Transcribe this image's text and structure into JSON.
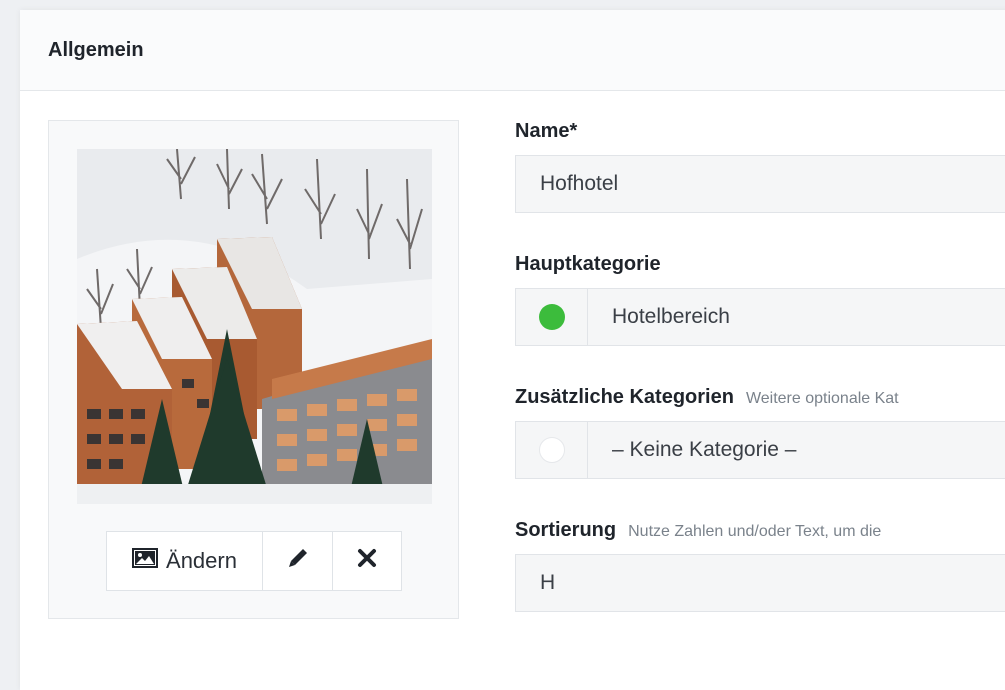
{
  "section": {
    "title": "Allgemein"
  },
  "image_actions": {
    "change_label": "Ändern"
  },
  "fields": {
    "name": {
      "label": "Name*",
      "value": "Hofhotel"
    },
    "main_category": {
      "label": "Hauptkategorie",
      "value": "Hotelbereich",
      "color": "#3cbc3c"
    },
    "additional_categories": {
      "label": "Zusätzliche Kategorien",
      "hint": "Weitere optionale Kat",
      "value": "– Keine Kategorie –"
    },
    "sorting": {
      "label": "Sortierung",
      "hint": "Nutze Zahlen und/oder Text, um die",
      "value": "H"
    }
  },
  "icons": {
    "change": "image-icon",
    "edit": "pencil-icon",
    "remove": "x-icon"
  }
}
